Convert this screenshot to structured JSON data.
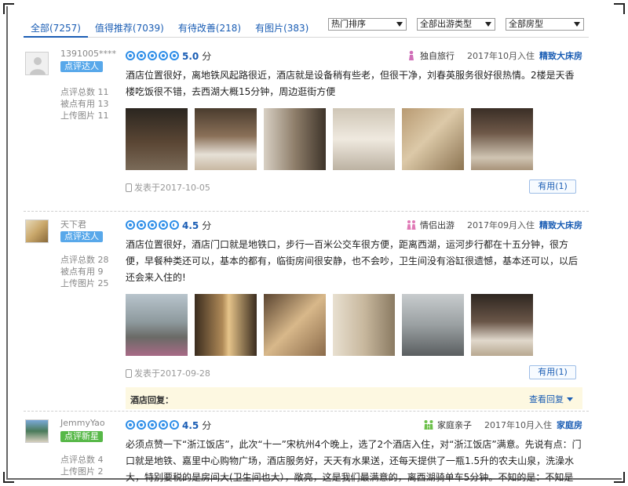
{
  "tabs": [
    {
      "label": "全部(7257)",
      "active": true
    },
    {
      "label": "值得推荐(7039)"
    },
    {
      "label": "有待改善(218)"
    },
    {
      "label": "有图片(383)"
    }
  ],
  "filters": {
    "sort": "热门排序",
    "trip_type": "全部出游类型",
    "room_type": "全部房型"
  },
  "reviews": [
    {
      "username": "1391005****",
      "badge": "点评达人",
      "stats": [
        "点评总数 11",
        "被点有用 13",
        "上传图片 11"
      ],
      "score": "5.0",
      "score_unit": "分",
      "trip_type": "独自旅行",
      "stay": "2017年10月入住",
      "room": "精致大床房",
      "text": "酒店位置很好，离地铁风起路很近，酒店就是设备稍有些老，但很干净，刘春英服务很好很热情。2楼是天香楼吃饭很不错，去西湖大概15分钟，周边逛街方便",
      "posted": "发表于2017-10-05",
      "useful": "有用(1)"
    },
    {
      "username": "天下君",
      "badge": "点评达人",
      "stats": [
        "点评总数 28",
        "被点有用 9",
        "上传图片 25"
      ],
      "score": "4.5",
      "score_unit": "分",
      "trip_type": "情侣出游",
      "stay": "2017年09月入住",
      "room": "精致大床房",
      "text": "酒店位置很好，酒店门口就是地铁口，步行一百米公交车很方便，距离西湖，运河步行都在十五分钟，很方便，早餐种类还可以，基本的都有，临街房间很安静，也不会吵，卫生间没有浴缸很遗憾，基本还可以，以后还会来入住的!",
      "posted": "发表于2017-09-28",
      "useful": "有用(1)",
      "reply_label": "酒店回复：",
      "reply_toggle": "查看回复"
    },
    {
      "username": "JemmyYao",
      "badge": "点评新星",
      "stats": [
        "点评总数 4",
        "上传图片 2"
      ],
      "score": "4.5",
      "score_unit": "分",
      "trip_type": "家庭亲子",
      "stay": "2017年10月入住",
      "room": "家庭房",
      "text": "必须点赞一下“浙江饭店”，此次“十一”宋杭州4个晚上，选了2个酒店入住，对“浙江饭店”满意。先说有点：门口就是地铁、嘉里中心购物广场，酒店服务好，天天有水果送，还每天提供了一瓶1.5升的农夫山泉，洗澡水大，特别要税的是房间大(卫生间也大），敞亮，这是我们最满意的，离西湖骑单车5分钟。不知的是：不知是否房间有些"
    }
  ],
  "colors": {
    "accent": "#1a5db4",
    "dot": "#2e8ee8",
    "badge_blue": "#58a8ea",
    "badge_green": "#57b848",
    "reply_bg": "#fdf8e1"
  }
}
